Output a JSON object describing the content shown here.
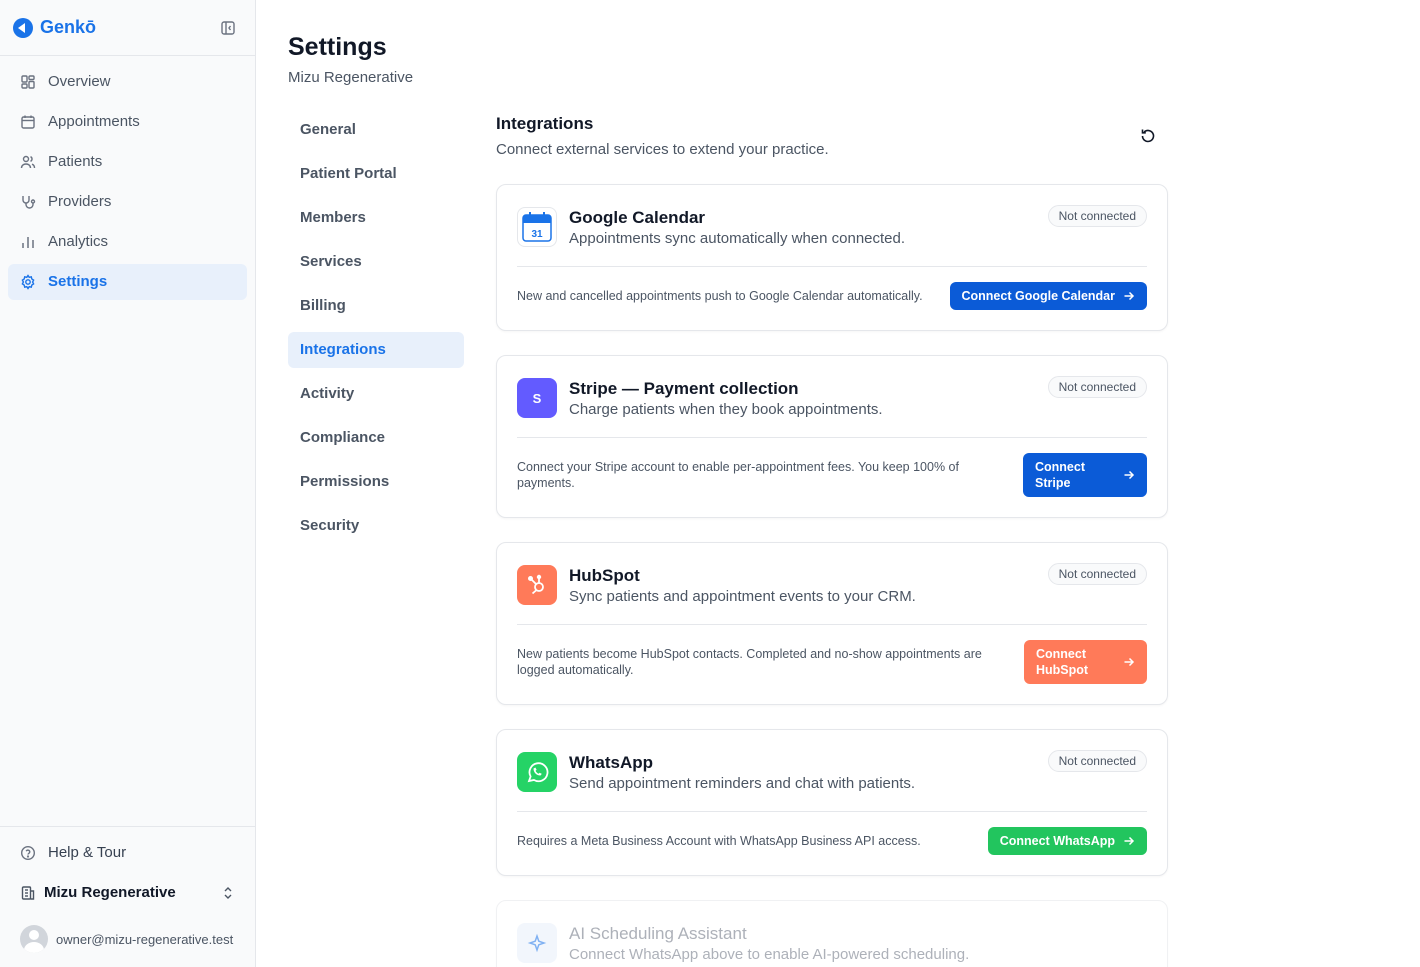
{
  "brand": {
    "name": "Genkō"
  },
  "sidebar": {
    "items": [
      {
        "label": "Overview",
        "icon": "grid-icon"
      },
      {
        "label": "Appointments",
        "icon": "calendar-icon"
      },
      {
        "label": "Patients",
        "icon": "users-icon"
      },
      {
        "label": "Providers",
        "icon": "stethoscope-icon"
      },
      {
        "label": "Analytics",
        "icon": "bar-chart-icon"
      },
      {
        "label": "Settings",
        "icon": "gear-icon",
        "active": true
      }
    ],
    "help_label": "Help & Tour",
    "org_name": "Mizu Regenerative",
    "user_email": "owner@mizu-regenerative.test"
  },
  "page": {
    "title": "Settings",
    "subtitle": "Mizu Regenerative"
  },
  "subnav": [
    "General",
    "Patient Portal",
    "Members",
    "Services",
    "Billing",
    "Integrations",
    "Activity",
    "Compliance",
    "Permissions",
    "Security"
  ],
  "subnav_active": "Integrations",
  "integrations": {
    "title": "Integrations",
    "description": "Connect external services to extend your practice.",
    "cards": [
      {
        "name": "Google Calendar",
        "description": "Appointments sync automatically when connected.",
        "status": "Not connected",
        "footnote": "New and cancelled appointments push to Google Calendar automatically.",
        "button": "Connect Google Calendar",
        "button_color": "#0b5bd7",
        "logo_color": "#1a73e8",
        "logo_text": "31"
      },
      {
        "name": "Stripe — Payment collection",
        "description": "Charge patients when they book appointments.",
        "status": "Not connected",
        "footnote": "Connect your Stripe account to enable per-appointment fees. You keep 100% of payments.",
        "button": "Connect Stripe",
        "button_color": "#0b5bd7",
        "logo_color": "#635bff",
        "logo_text": "S"
      },
      {
        "name": "HubSpot",
        "description": "Sync patients and appointment events to your CRM.",
        "status": "Not connected",
        "footnote": "New patients become HubSpot contacts. Completed and no-show appointments are logged automatically.",
        "button": "Connect HubSpot",
        "button_color": "#ff7a59",
        "logo_color": "#ff7a59"
      },
      {
        "name": "WhatsApp",
        "description": "Send appointment reminders and chat with patients.",
        "status": "Not connected",
        "footnote": "Requires a Meta Business Account with WhatsApp Business API access.",
        "button": "Connect WhatsApp",
        "button_color": "#22c55e",
        "logo_color": "#25d366"
      },
      {
        "name": "AI Scheduling Assistant",
        "description": "Connect WhatsApp above to enable AI-powered scheduling.",
        "logo_color": "#e8f0fb"
      }
    ]
  }
}
